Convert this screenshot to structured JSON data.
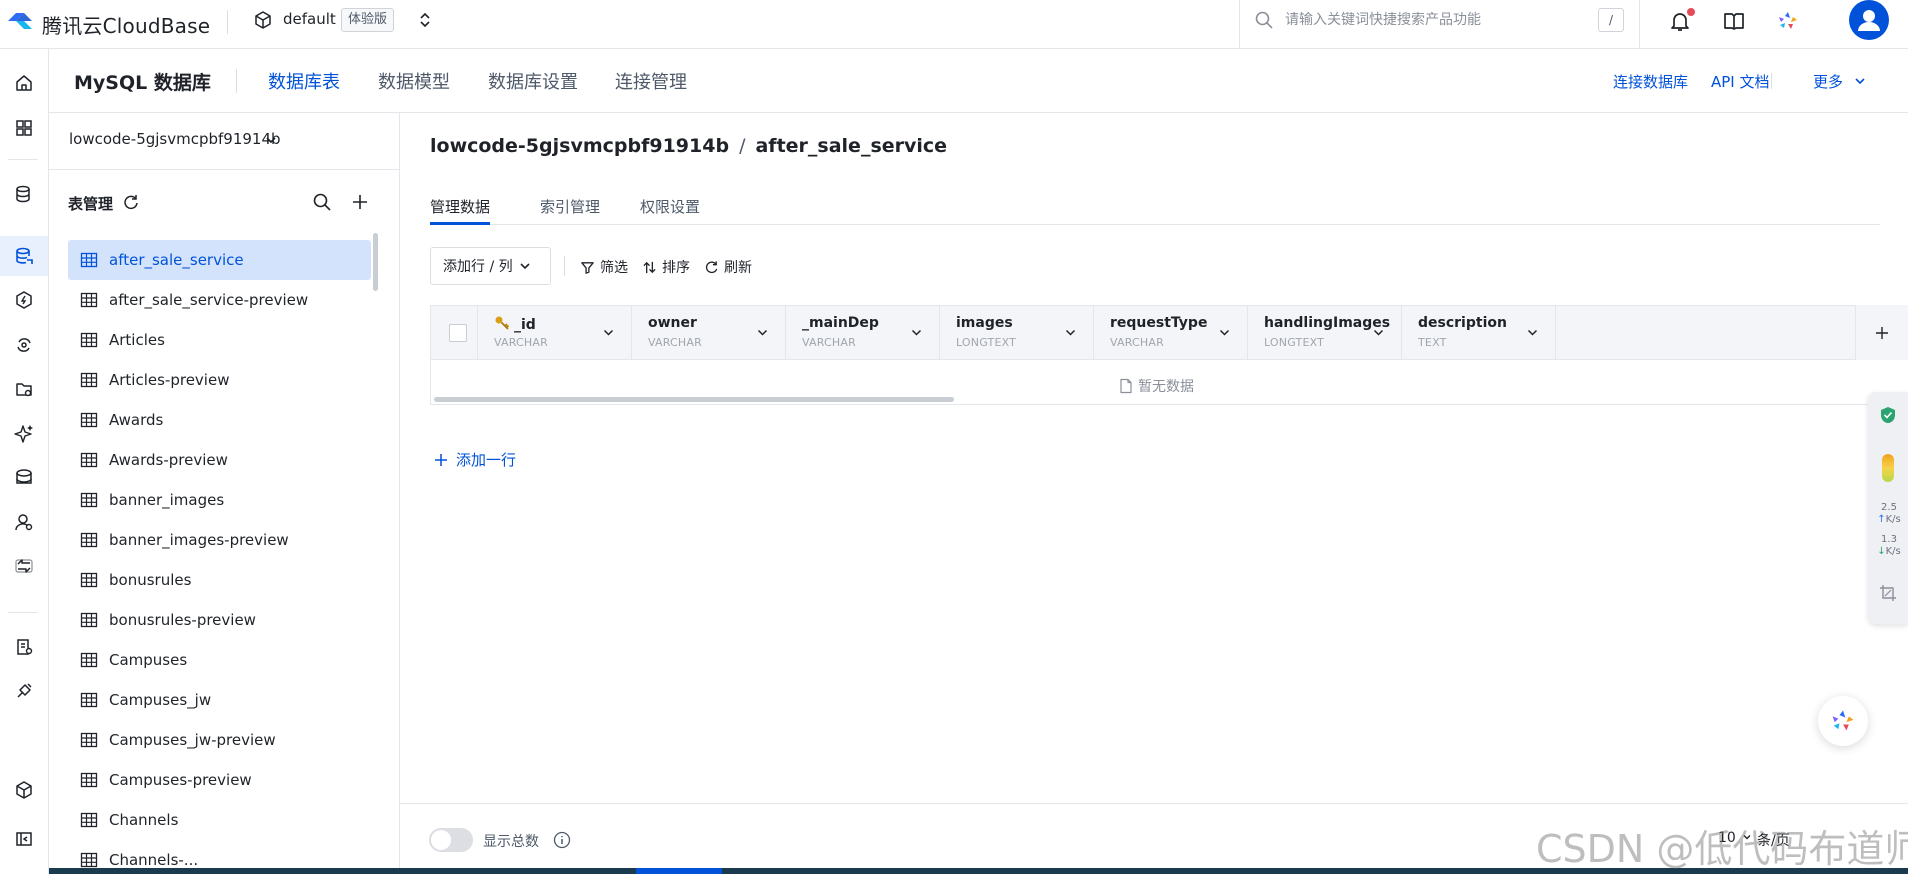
{
  "header": {
    "brand": "腾讯云CloudBase",
    "env_name": "default",
    "env_badge": "体验版",
    "search_placeholder": "请输入关键词快捷搜索产品功能",
    "search_shortcut": "/",
    "icons": [
      "bell-icon",
      "book-icon",
      "ai-assistant-icon",
      "user-avatar-icon"
    ],
    "accent_color": "#0052d9",
    "notification_dot_color": "#e34d59"
  },
  "rail": {
    "icons": [
      "home-icon",
      "apps-grid-icon",
      "database-icon",
      "mysql-database-icon",
      "cloud-function-icon",
      "integration-icon",
      "storage-icon",
      "ai-sparkle-icon",
      "cloud-hosting-icon",
      "user-auth-icon",
      "exchange-icon",
      "logs-icon",
      "extension-icon",
      "cube-icon",
      "collapse-sidebar-icon"
    ],
    "active": "mysql-database-icon"
  },
  "module": {
    "title": "MySQL 数据库",
    "tabs": [
      {
        "label": "数据库表",
        "active": true
      },
      {
        "label": "数据模型",
        "active": false
      },
      {
        "label": "数据库设置",
        "active": false
      },
      {
        "label": "连接管理",
        "active": false
      }
    ],
    "links": {
      "connect": "连接数据库",
      "api_docs": "API 文档",
      "more": "更多"
    }
  },
  "sidebar": {
    "db_name": "lowcode-5gjsvmcpbf91914b",
    "section_title": "表管理",
    "tables": [
      {
        "label": "after_sale_service",
        "selected": true
      },
      {
        "label": "after_sale_service-preview"
      },
      {
        "label": "Articles"
      },
      {
        "label": "Articles-preview"
      },
      {
        "label": "Awards"
      },
      {
        "label": "Awards-preview"
      },
      {
        "label": "banner_images"
      },
      {
        "label": "banner_images-preview"
      },
      {
        "label": "bonusrules"
      },
      {
        "label": "bonusrules-preview"
      },
      {
        "label": "Campuses"
      },
      {
        "label": "Campuses_jw"
      },
      {
        "label": "Campuses_jw-preview"
      },
      {
        "label": "Campuses-preview"
      },
      {
        "label": "Channels"
      },
      {
        "label": "Channels-..."
      }
    ]
  },
  "main": {
    "breadcrumb": {
      "db": "lowcode-5gjsvmcpbf91914b",
      "sep": "/",
      "table": "after_sale_service"
    },
    "subtabs": [
      {
        "label": "管理数据",
        "active": true
      },
      {
        "label": "索引管理",
        "active": false
      },
      {
        "label": "权限设置",
        "active": false
      }
    ],
    "toolbar": {
      "add_rowcol": "添加行 / 列",
      "filter": "筛选",
      "sort": "排序",
      "refresh": "刷新"
    },
    "columns": [
      {
        "name": "_id",
        "type": "VARCHAR",
        "primary_key": true
      },
      {
        "name": "owner",
        "type": "VARCHAR"
      },
      {
        "name": "_mainDep",
        "type": "VARCHAR"
      },
      {
        "name": "images",
        "type": "LONGTEXT"
      },
      {
        "name": "requestType",
        "type": "VARCHAR"
      },
      {
        "name": "handlingImages",
        "type": "LONGTEXT"
      },
      {
        "name": "description",
        "type": "TEXT"
      }
    ],
    "empty_text": "暂无数据",
    "add_row": "添加一行",
    "footer": {
      "show_total_label": "显示总数",
      "show_total_enabled": false,
      "page_size": "10",
      "page_unit": "条/页"
    }
  },
  "float_panel": {
    "upload_speed": "2.5",
    "download_speed": "1.3",
    "speed_unit": "K/s"
  },
  "watermark": "CSDN @低代码布道师"
}
